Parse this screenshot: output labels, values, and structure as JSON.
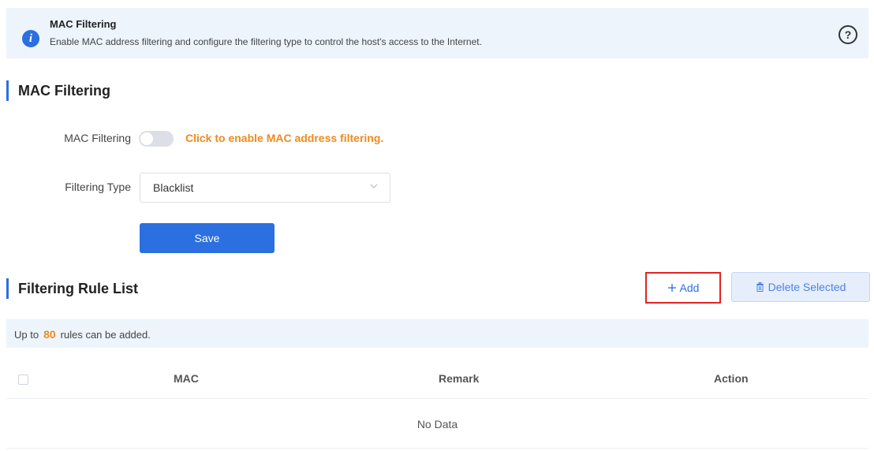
{
  "banner": {
    "title": "MAC Filtering",
    "description": "Enable MAC address filtering and configure the filtering type to control the host's access to the Internet.",
    "info_icon": "info-icon",
    "help_icon": "help-icon",
    "info_glyph": "i",
    "help_glyph": "?"
  },
  "settings": {
    "section_title": "MAC Filtering",
    "mac_filtering_label": "MAC Filtering",
    "toggle_state": "off",
    "toggle_hint": "Click to enable MAC address filtering.",
    "filtering_type_label": "Filtering Type",
    "filtering_type_value": "Blacklist",
    "save_label": "Save"
  },
  "rule_list": {
    "section_title": "Filtering Rule List",
    "add_label": "Add",
    "delete_label": "Delete Selected",
    "limit_prefix": "Up to",
    "limit_count": "80",
    "limit_suffix": "rules can be added.",
    "columns": [
      "MAC",
      "Remark",
      "Action"
    ],
    "empty_text": "No Data"
  },
  "colors": {
    "accent": "#2b6fe0",
    "hint_orange": "#f08a1e",
    "highlight_red": "#e02424",
    "banner_bg": "#edf4fc"
  }
}
